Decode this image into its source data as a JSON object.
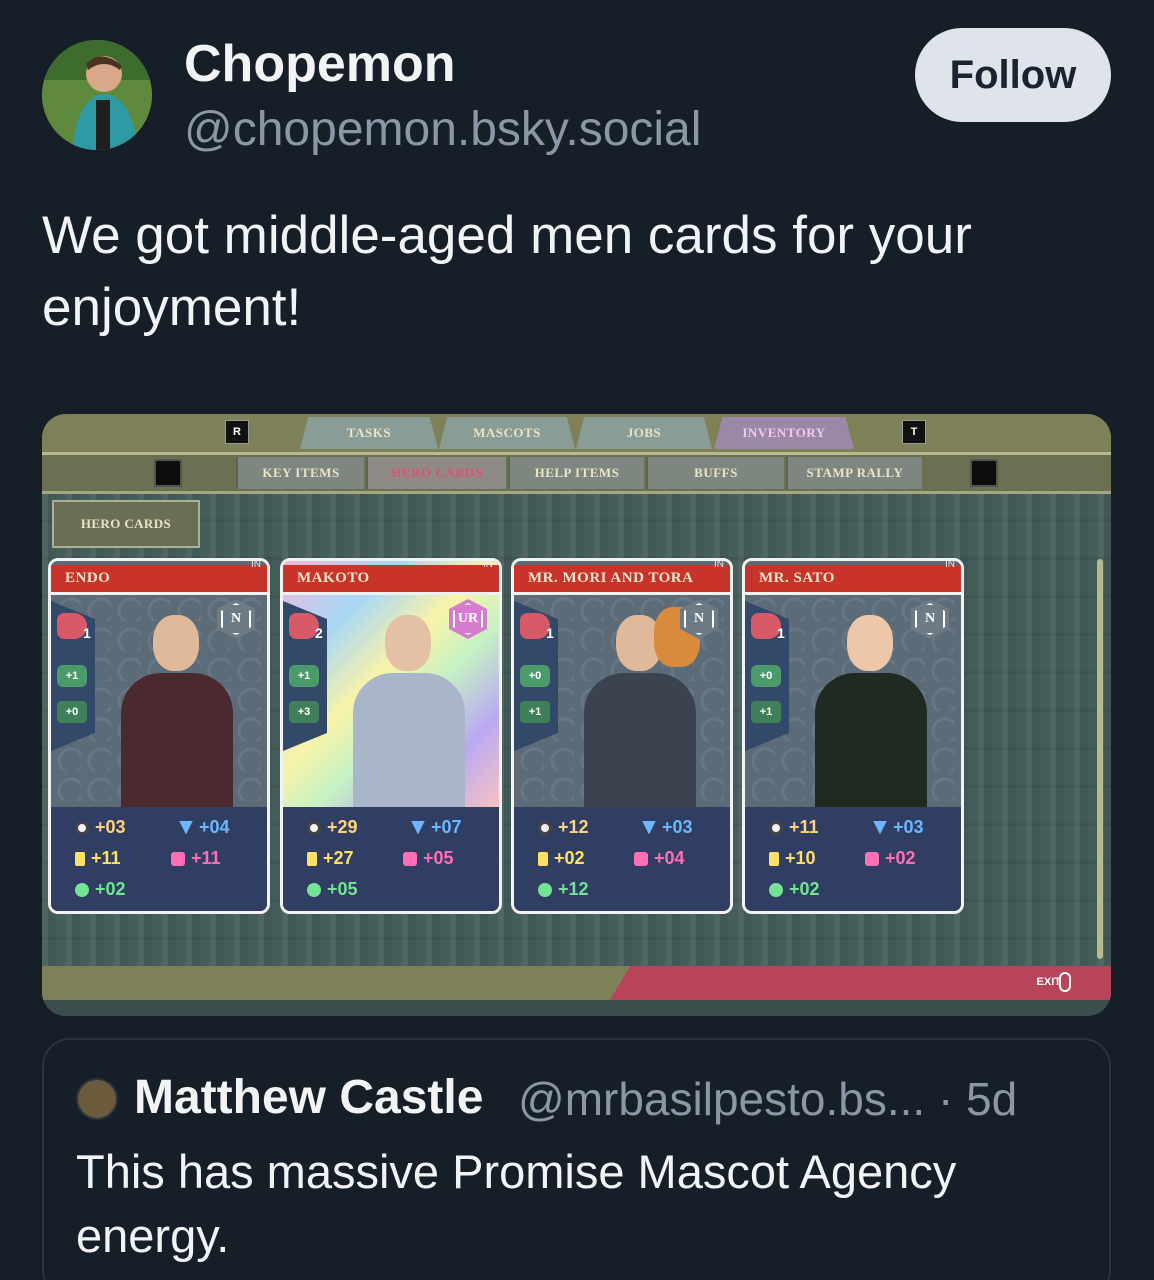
{
  "post": {
    "author": {
      "display_name": "Chopemon",
      "handle": "@chopemon.bsky.social",
      "avatar_icon": "user-avatar"
    },
    "follow_label": "Follow",
    "text": "We got middle-aged men cards for your enjoyment!"
  },
  "game_screen": {
    "top_tabs": [
      "TASKS",
      "MASCOTS",
      "JOBS",
      "INVENTORY"
    ],
    "top_tabs_active": "INVENTORY",
    "top_key_left": "R",
    "top_key_right": "T",
    "sub_tabs": [
      "KEY ITEMS",
      "HERO CARDS",
      "HELP ITEMS",
      "BUFFS",
      "STAMP RALLY"
    ],
    "sub_tabs_active": "HERO CARDS",
    "section_title": "HERO CARDS",
    "cards": [
      {
        "name": "ENDO",
        "in_tag": "IN",
        "rarity": "N",
        "hand": "1",
        "mod1": "+1",
        "mod2": "+0",
        "stats": {
          "sun": "+03",
          "drop": "+04",
          "bang": "+11",
          "team": "+11",
          "paw": "+02"
        },
        "suit_color": "#4a2a2e"
      },
      {
        "name": "MAKOTO",
        "in_tag": "IN",
        "rarity": "UR",
        "hand": "2",
        "mod1": "+1",
        "mod2": "+3",
        "stats": {
          "sun": "+29",
          "drop": "+07",
          "bang": "+27",
          "team": "+05",
          "paw": "+05"
        },
        "suit_color": "#a9b5c9"
      },
      {
        "name": "MR. MORI AND TORA",
        "in_tag": "IN",
        "rarity": "N",
        "hand": "1",
        "mod1": "+0",
        "mod2": "+1",
        "stats": {
          "sun": "+12",
          "drop": "+03",
          "bang": "+02",
          "team": "+04",
          "paw": "+12"
        },
        "suit_color": "#3b4250"
      },
      {
        "name": "MR. SATO",
        "in_tag": "IN",
        "rarity": "N",
        "hand": "1",
        "mod1": "+0",
        "mod2": "+1",
        "stats": {
          "sun": "+11",
          "drop": "+03",
          "bang": "+10",
          "team": "+02",
          "paw": "+02"
        },
        "suit_color": "#1f2a22"
      }
    ],
    "exit_label": "EXIT"
  },
  "quoted_post": {
    "display_name": "Matthew Castle",
    "handle_and_time": "@mrbasilpesto.bs... · 5d",
    "text": "This has massive Promise Mascot Agency energy."
  },
  "colors": {
    "background": "#161e27",
    "handle_grey": "#8a97a6",
    "follow_bg": "#dfe4ea",
    "card_header_red": "#c8332a",
    "inventory_tab_active": "#9b88a8"
  }
}
